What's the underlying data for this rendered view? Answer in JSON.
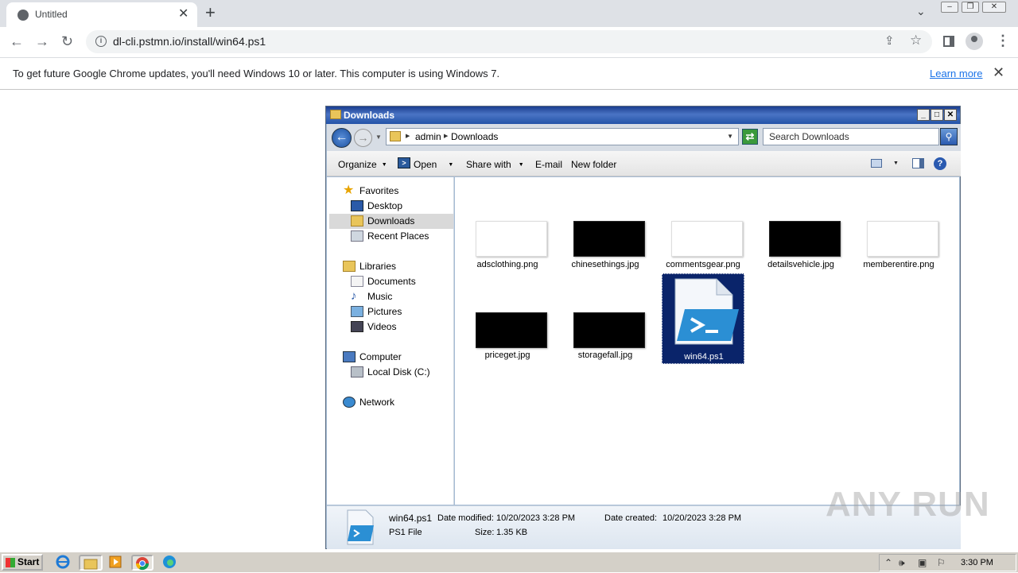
{
  "browser": {
    "tab_title": "Untitled",
    "url": "dl-cli.pstmn.io/install/win64.ps1",
    "infobar_message": "To get future Google Chrome updates, you'll need Windows 10 or later. This computer is using Windows 7.",
    "learn_more": "Learn more"
  },
  "explorer": {
    "title": "Downloads",
    "breadcrumb": [
      "admin",
      "Downloads"
    ],
    "search_placeholder": "Search Downloads",
    "commands": {
      "organize": "Organize",
      "open": "Open",
      "share_with": "Share with",
      "email": "E-mail",
      "new_folder": "New folder"
    },
    "nav": {
      "favorites": "Favorites",
      "desktop": "Desktop",
      "downloads": "Downloads",
      "recent_places": "Recent Places",
      "libraries": "Libraries",
      "documents": "Documents",
      "music": "Music",
      "pictures": "Pictures",
      "videos": "Videos",
      "computer": "Computer",
      "local_disk": "Local Disk (C:)",
      "network": "Network"
    },
    "files": [
      {
        "name": "adsclothing.png",
        "thumb": "#ffffff"
      },
      {
        "name": "chinesethings.jpg",
        "thumb": "#000000"
      },
      {
        "name": "commentsgear.png",
        "thumb": "#ffffff"
      },
      {
        "name": "detailsvehicle.jpg",
        "thumb": "#000000"
      },
      {
        "name": "memberentire.png",
        "thumb": "#ffffff"
      },
      {
        "name": "priceget.jpg",
        "thumb": "#000000"
      },
      {
        "name": "storagefall.jpg",
        "thumb": "#000000"
      },
      {
        "name": "win64.ps1",
        "thumb": "powershell-icon"
      }
    ],
    "status": {
      "name": "win64.ps1",
      "type": "PS1 File",
      "modified_label": "Date modified:",
      "modified": "10/20/2023 3:28 PM",
      "created_label": "Date created:",
      "created": "10/20/2023 3:28 PM",
      "size_label": "Size:",
      "size": "1.35 KB"
    }
  },
  "watermark": "ANY RUN",
  "taskbar": {
    "start": "Start",
    "clock": "3:30 PM"
  }
}
